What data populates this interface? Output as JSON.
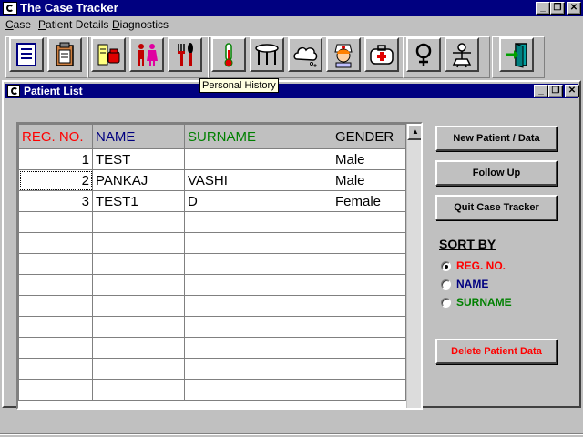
{
  "app": {
    "title": "The Case Tracker",
    "controls": {
      "minimize": "_",
      "restore": "❐",
      "close": "✕"
    }
  },
  "menu": [
    {
      "underline": "C",
      "rest": "ase"
    },
    {
      "underline": "P",
      "rest": "atient Details"
    },
    {
      "underline": "D",
      "rest": "iagnostics"
    }
  ],
  "toolbar": {
    "tooltip": "Personal History",
    "icons": [
      "notepad-icon",
      "clipboard-icon",
      "phone-book-icon",
      "family-icon",
      "fork-knife-icon",
      "thermometer-icon",
      "stool-icon",
      "cloud-icon",
      "nurse-icon",
      "medical-kit-icon",
      "female-symbol-icon",
      "child-icon",
      "exit-door-icon"
    ]
  },
  "child": {
    "title": "Patient List"
  },
  "grid": {
    "headers": [
      {
        "label": "REG. NO.",
        "color": "#ff0000"
      },
      {
        "label": "NAME",
        "color": "#000080"
      },
      {
        "label": "SURNAME",
        "color": "#008000"
      },
      {
        "label": "GENDER",
        "color": "#000000"
      }
    ],
    "rows": [
      {
        "reg": "1",
        "name": "TEST",
        "surname": "",
        "gender": "Male"
      },
      {
        "reg": "2",
        "name": "PANKAJ",
        "surname": "VASHI",
        "gender": "Male"
      },
      {
        "reg": "3",
        "name": "TEST1",
        "surname": "D",
        "gender": "Female"
      }
    ],
    "empty_rows": 9
  },
  "buttons": {
    "new_patient": "New Patient / Data",
    "follow_up": "Follow Up",
    "quit": "Quit Case Tracker",
    "delete": "Delete Patient Data"
  },
  "sort": {
    "title": "SORT BY",
    "options": [
      {
        "label": "REG. NO.",
        "color": "#ff0000",
        "selected": true
      },
      {
        "label": "NAME",
        "color": "#000080",
        "selected": false
      },
      {
        "label": "SURNAME",
        "color": "#008000",
        "selected": false
      }
    ]
  },
  "colors": {
    "titlebar": "#000080",
    "face": "#c0c0c0",
    "delete_text": "#ff0000"
  }
}
